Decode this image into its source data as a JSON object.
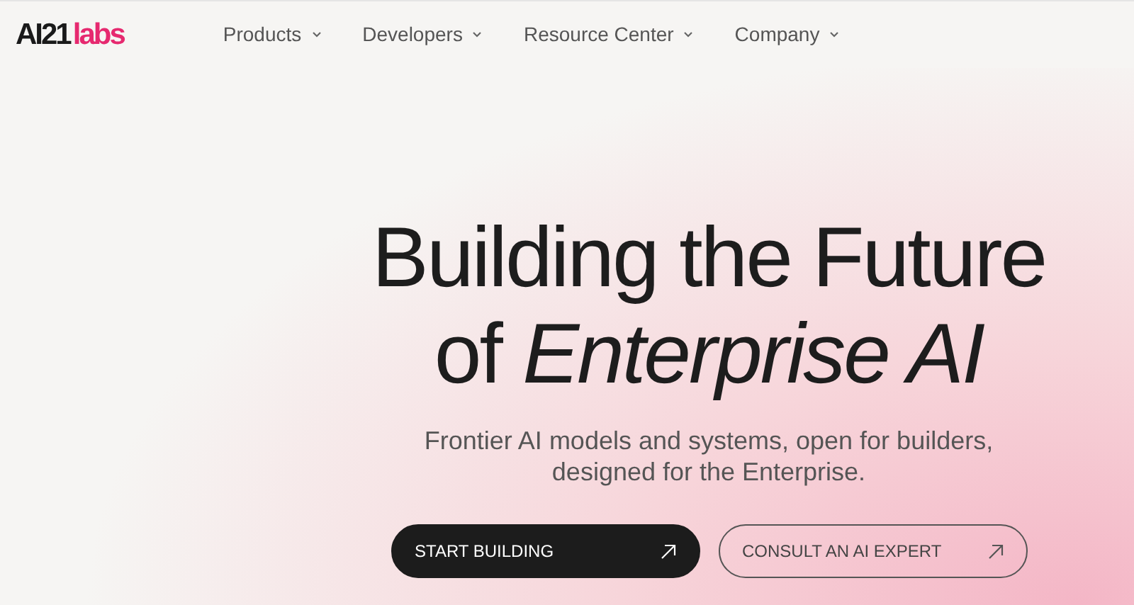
{
  "logo": {
    "primary": "AI21",
    "secondary": "labs"
  },
  "nav": [
    {
      "label": "Products",
      "has_menu": true
    },
    {
      "label": "Developers",
      "has_menu": true
    },
    {
      "label": "Resource Center",
      "has_menu": true
    },
    {
      "label": "Company",
      "has_menu": true
    }
  ],
  "hero": {
    "title_lines": [
      "Building the Future",
      "of *Enterprise AI*"
    ],
    "subtitle_lines": [
      "Frontier AI models and systems, open for builders,",
      "designed for the Enterprise."
    ],
    "buttons": [
      {
        "label": "START BUILDING",
        "kind": "primary"
      },
      {
        "label": "CONSULT AN AI EXPERT",
        "kind": "secondary"
      }
    ]
  }
}
